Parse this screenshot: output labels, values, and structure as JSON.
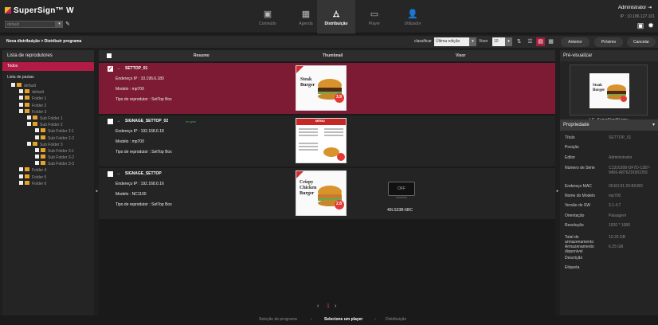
{
  "app": {
    "logo": "SuperSign™ W",
    "site": "default",
    "user": "Administrator",
    "ip": "IP : 10.186.127.101"
  },
  "nav": [
    {
      "label": "Conteúdo",
      "icon": "content-icon"
    },
    {
      "label": "Agenda",
      "icon": "calendar-icon"
    },
    {
      "label": "Distribuição",
      "icon": "distribution-icon",
      "active": true
    },
    {
      "label": "Player",
      "icon": "player-icon"
    },
    {
      "label": "Utilizador",
      "icon": "user-icon"
    }
  ],
  "breadcrumb": "Nova distribuição > Distribuir programa",
  "toolbar": {
    "sort_label": "classificar",
    "sort_value": "Última edição",
    "view_label": "Visor",
    "view_value": "10",
    "prev": "Anterior",
    "next": "Próximo",
    "cancel": "Cancelar"
  },
  "left": {
    "title": "Lista de reprodutores",
    "all": "Todos",
    "folders_title": "Lista de pastas",
    "tree": [
      {
        "label": "default",
        "level": 0
      },
      {
        "label": "default",
        "level": 1
      },
      {
        "label": "Folder 1",
        "level": 1
      },
      {
        "label": "Folder 2",
        "level": 1
      },
      {
        "label": "Folder 3",
        "level": 1
      },
      {
        "label": "Sub Folder 1",
        "level": 2
      },
      {
        "label": "Sub Folder 2",
        "level": 2
      },
      {
        "label": "Sub Folder 2-1",
        "level": 3
      },
      {
        "label": "Sub Folder 2-2",
        "level": 3
      },
      {
        "label": "Sub Folder 3",
        "level": 2
      },
      {
        "label": "Sub Folder 3-1",
        "level": 3
      },
      {
        "label": "Sub Folder 3-2",
        "level": 3
      },
      {
        "label": "Sub Folder 3-3",
        "level": 3
      },
      {
        "label": "Folder 4",
        "level": 1
      },
      {
        "label": "Folder 5",
        "level": 1
      },
      {
        "label": "Folder 6",
        "level": 1
      }
    ]
  },
  "columns": {
    "summary": "Resumo",
    "thumbnail": "Thumbnail",
    "visor": "Visor"
  },
  "rows": [
    {
      "name": "SETTOP_01",
      "sync": "",
      "ip": "Endereço IP : 10.196.6.180",
      "model": "Modelo : mp700",
      "type": "Tipo de reprodutor : SetTop Box",
      "thumb_title": "Steak Burger",
      "price": "3.9",
      "selected": true,
      "tv": ""
    },
    {
      "name": "SIGNAGE_SETTOP_02",
      "sync": "re-sync",
      "ip": "Endereço IP : 192.168.0.18",
      "model": "Modelo : mp700",
      "type": "Tipo de reprodutor : SetTop Box",
      "thumb_title": "MENU",
      "price": "",
      "selected": false,
      "tv": ""
    },
    {
      "name": "SIGNAGE_SETTOP",
      "sync": "",
      "ip": "Endereço IP : 192.168.0.16",
      "model": "Modelo : NC1100",
      "type": "Tipo de reprodutor : SetTop Box",
      "thumb_title": "Crispy Chicken Burger",
      "price": "2.8",
      "selected": false,
      "tv": "OFF",
      "tv_label": "49LS33B-5BC"
    }
  ],
  "pager": {
    "page": "1"
  },
  "steps": [
    "Seleção de programa",
    "Selecione um player",
    "Distribuição"
  ],
  "right": {
    "title": "Pré-visualizar",
    "preview_name": "LG_SuperSignW.wmv",
    "props_title": "Propriedade",
    "props": [
      {
        "k": "Título",
        "v": "SETTOP_01"
      },
      {
        "k": "Posição",
        "v": ""
      },
      {
        "k": "Editor",
        "v": "Administrator"
      },
      {
        "k": "Número de Série",
        "v": "C1316308-DF7D-1387-9456-A876ZD08C059"
      },
      {
        "k": "Endereço MAC",
        "v": "00:E0:91:20:B9:BD"
      },
      {
        "k": "Nome do Modelo",
        "v": "mp700"
      },
      {
        "k": "Versão do SW",
        "v": "3.1.4.7"
      },
      {
        "k": "Orientação",
        "v": "Paisagem"
      },
      {
        "k": "Resolução",
        "v": "1920 * 1080"
      },
      {
        "k": "Total de armazenamento",
        "v": "10.29 GB"
      },
      {
        "k": "Armazenamento disponível",
        "v": "6.25 GB"
      },
      {
        "k": "Descrição",
        "v": ""
      },
      {
        "k": "Etiqueta",
        "v": ""
      }
    ]
  }
}
